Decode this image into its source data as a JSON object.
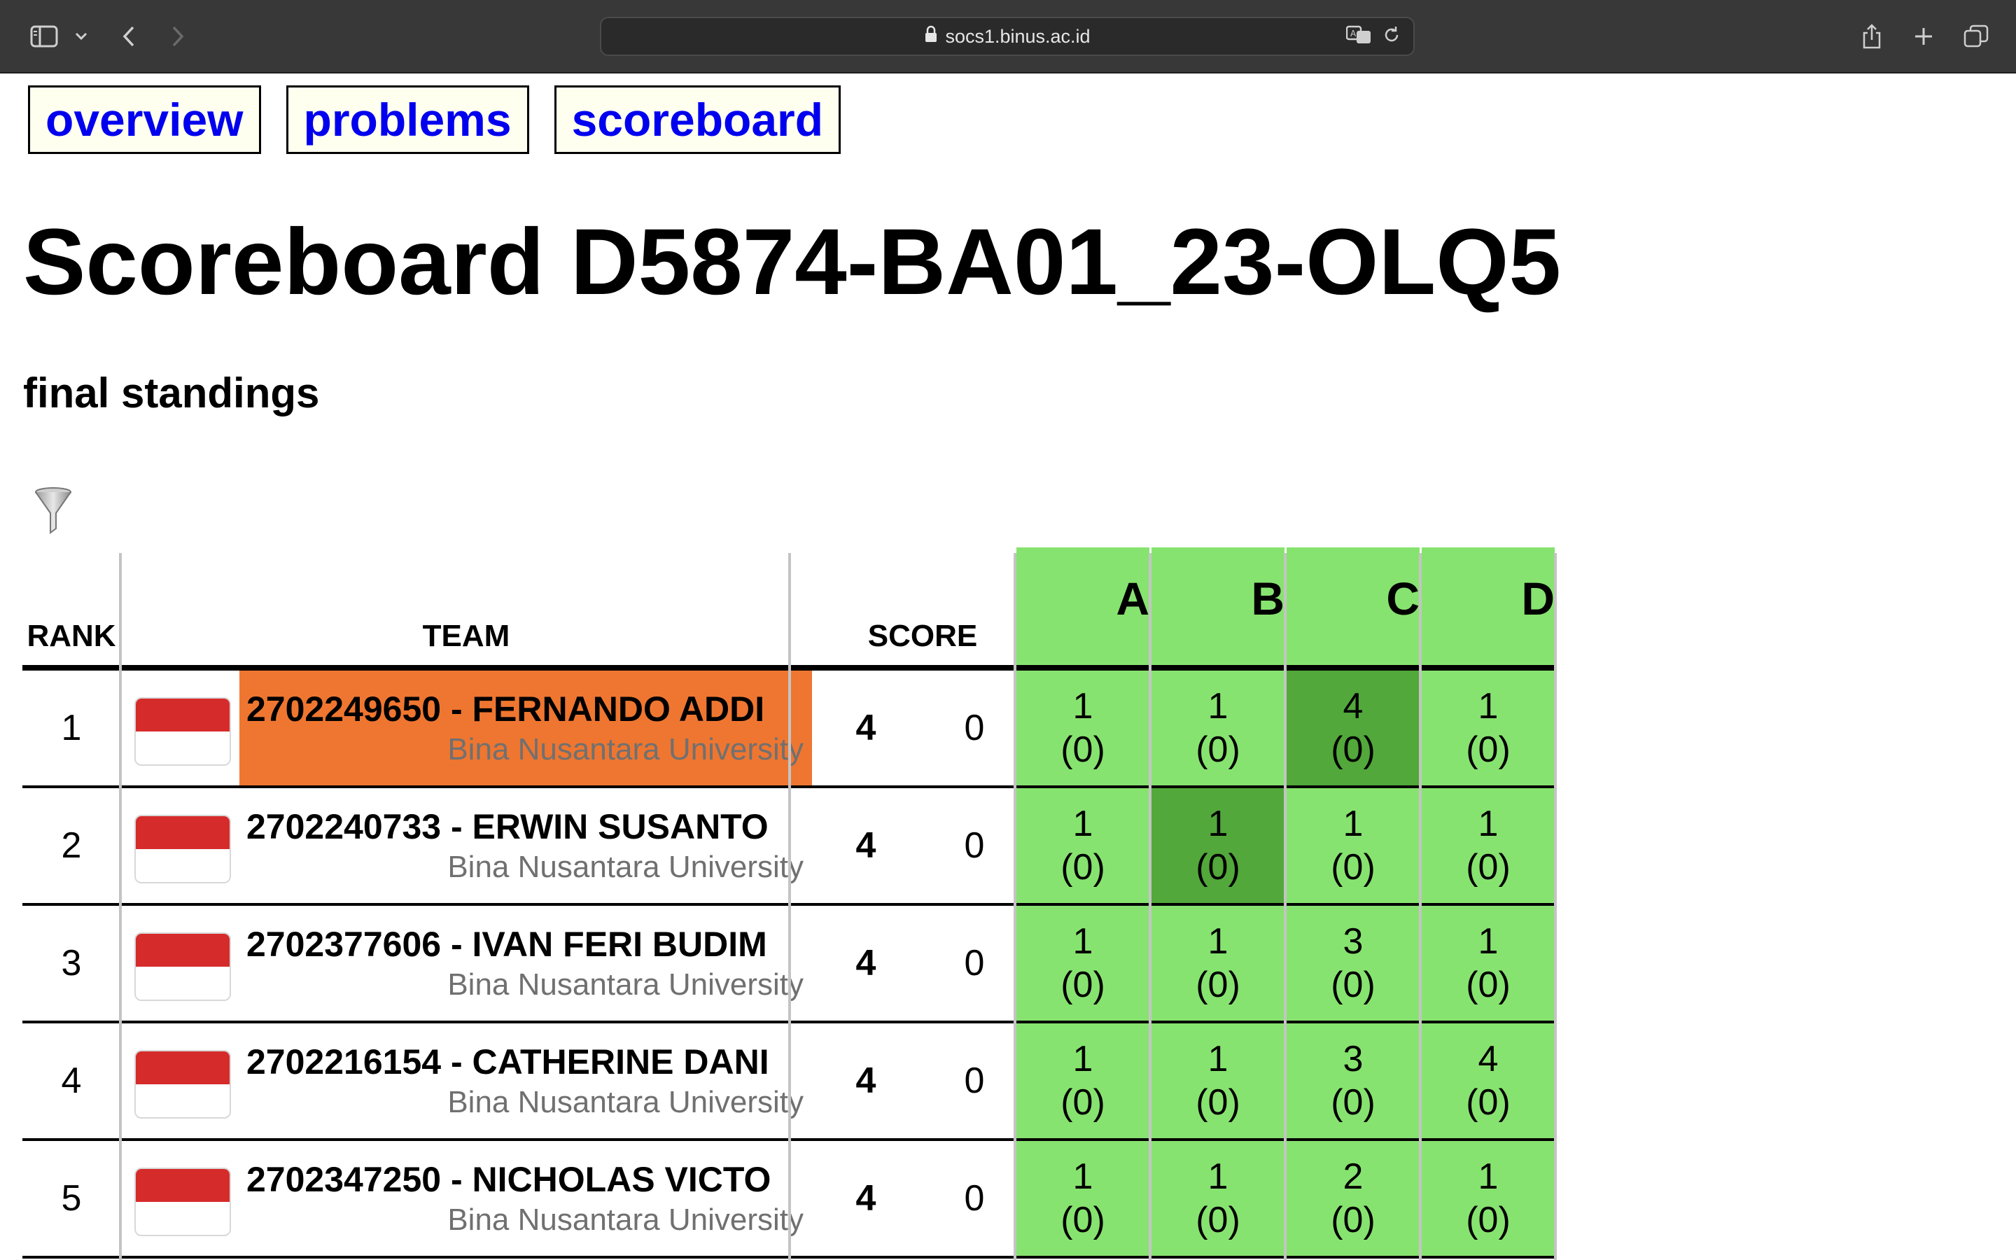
{
  "browser": {
    "url": "socs1.binus.ac.id",
    "icons": [
      "sidebar-icon",
      "chevron-down-icon",
      "back-icon",
      "forward-icon",
      "lock-icon",
      "translate-icon",
      "reload-icon",
      "share-icon",
      "new-tab-icon",
      "tabs-overview-icon"
    ]
  },
  "nav": {
    "overview": "overview",
    "problems": "problems",
    "scoreboard": "scoreboard"
  },
  "page": {
    "title": "Scoreboard D5874-BA01_23-OLQ5",
    "subtitle": "final standings"
  },
  "table": {
    "headers": {
      "rank": "RANK",
      "team": "TEAM",
      "score": "SCORE"
    },
    "problems": [
      "A",
      "B",
      "C",
      "D"
    ],
    "rows": [
      {
        "rank": "1",
        "team": "2702249650 - FERNANDO ADDI",
        "affiliation": "Bina Nusantara University",
        "points": "4",
        "penalty": "0",
        "highlight": true,
        "cells": [
          {
            "tries": "1",
            "pen": "(0)"
          },
          {
            "tries": "1",
            "pen": "(0)"
          },
          {
            "tries": "4",
            "pen": "(0)"
          },
          {
            "tries": "1",
            "pen": "(0)"
          }
        ]
      },
      {
        "rank": "2",
        "team": "2702240733 - ERWIN SUSANTO",
        "affiliation": "Bina Nusantara University",
        "points": "4",
        "penalty": "0",
        "highlight": false,
        "cells": [
          {
            "tries": "1",
            "pen": "(0)"
          },
          {
            "tries": "1",
            "pen": "(0)"
          },
          {
            "tries": "1",
            "pen": "(0)"
          },
          {
            "tries": "1",
            "pen": "(0)"
          }
        ]
      },
      {
        "rank": "3",
        "team": "2702377606 - IVAN FERI BUDIM",
        "affiliation": "Bina Nusantara University",
        "points": "4",
        "penalty": "0",
        "highlight": false,
        "cells": [
          {
            "tries": "1",
            "pen": "(0)"
          },
          {
            "tries": "1",
            "pen": "(0)"
          },
          {
            "tries": "3",
            "pen": "(0)"
          },
          {
            "tries": "1",
            "pen": "(0)"
          }
        ]
      },
      {
        "rank": "4",
        "team": "2702216154 - CATHERINE DANI",
        "affiliation": "Bina Nusantara University",
        "points": "4",
        "penalty": "0",
        "highlight": false,
        "cells": [
          {
            "tries": "1",
            "pen": "(0)"
          },
          {
            "tries": "1",
            "pen": "(0)"
          },
          {
            "tries": "3",
            "pen": "(0)"
          },
          {
            "tries": "4",
            "pen": "(0)"
          }
        ]
      },
      {
        "rank": "5",
        "team": "2702347250 - NICHOLAS VICTO",
        "affiliation": "Bina Nusantara University",
        "points": "4",
        "penalty": "0",
        "highlight": false,
        "cells": [
          {
            "tries": "1",
            "pen": "(0)"
          },
          {
            "tries": "1",
            "pen": "(0)"
          },
          {
            "tries": "2",
            "pen": "(0)"
          },
          {
            "tries": "1",
            "pen": "(0)"
          }
        ]
      }
    ]
  },
  "colors": {
    "solved": "#87e36f",
    "first_solve": "#52a83a",
    "team_highlight": "#ef7630",
    "nav_link": "#0000ee"
  }
}
